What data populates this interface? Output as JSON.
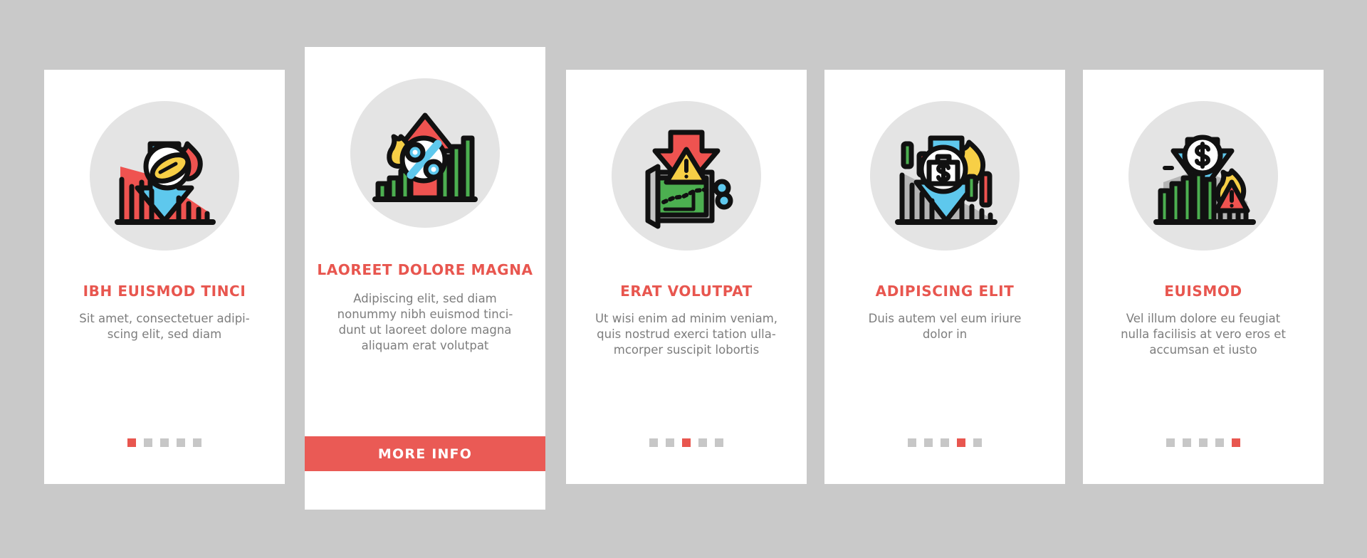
{
  "theme": {
    "background": "#c9c9c9",
    "card_background": "#ffffff",
    "accent": "#e8564f",
    "title_color": "#e8564f",
    "body_color": "#7d7d7d",
    "icon_disc_color": "#e4e4e4",
    "dot_inactive": "#c7c7c7",
    "button_color": "#ea5a55",
    "button_text_color": "#ffffff"
  },
  "pagination": {
    "total": 5
  },
  "cards": [
    {
      "icon_name": "coin-falling-chart-fire-icon",
      "title": "IBH EUISMOD TINCI",
      "body": "Sit amet, consectetuer adipi-\nscing elit, sed diam",
      "body_lines": [
        "Sit amet, consectetuer adipi-",
        "scing elit, sed diam"
      ],
      "active_dot": 1,
      "featured": false
    },
    {
      "icon_name": "percent-rising-arrow-fire-icon",
      "title": "LAOREET DOLORE MAGNA",
      "body": "Adipiscing elit, sed diam nonummy nibh euismod tincidunt ut laoreet dolore magna aliquam erat volutpat",
      "body_lines": [
        "Adipiscing elit, sed diam",
        "nonummy nibh euismod tinci-",
        "dunt ut laoreet dolore magna",
        "aliquam erat volutpat"
      ],
      "active_dot": 2,
      "featured": true,
      "button_label": "MORE INFO"
    },
    {
      "icon_name": "warning-down-arrow-screen-icon",
      "title": "ERAT VOLUTPAT",
      "body": "Ut wisi enim ad minim veniam, quis nostrud exerci tation ullamcorper suscipit lobortis",
      "body_lines": [
        "Ut wisi enim ad minim veniam,",
        "quis nostrud exerci tation ulla-",
        "mcorper suscipit lobortis"
      ],
      "active_dot": 3,
      "featured": false
    },
    {
      "icon_name": "briefcase-dollar-down-arrow-fire-icon",
      "title": "ADIPISCING ELIT",
      "body": "Duis autem vel eum iriure dolor in",
      "body_lines": [
        "Duis autem vel eum iriure",
        "dolor in"
      ],
      "active_dot": 4,
      "featured": false
    },
    {
      "icon_name": "dollar-down-arrow-fire-warning-icon",
      "title": "EUISMOD",
      "body": "Vel illum dolore eu feugiat nulla facilisis at vero eros et accumsan et iusto",
      "body_lines": [
        "Vel illum dolore eu feugiat",
        "nulla facilisis at vero eros et",
        "accumsan et iusto"
      ],
      "active_dot": 5,
      "featured": false
    }
  ]
}
